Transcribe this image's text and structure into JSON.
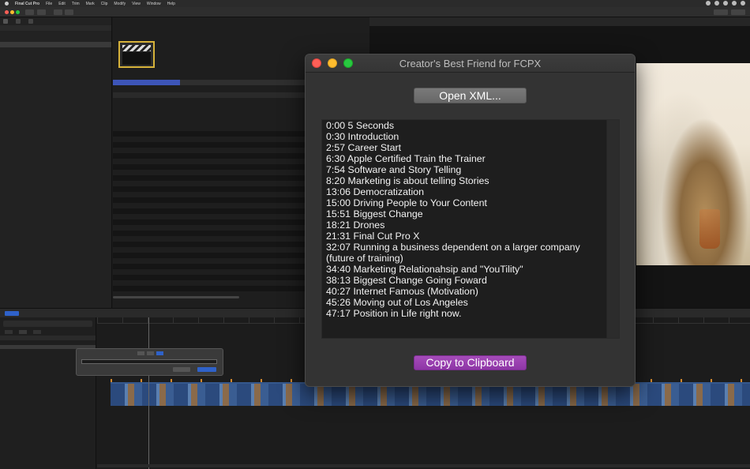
{
  "menubar": {
    "items": [
      "Final Cut Pro",
      "File",
      "Edit",
      "Trim",
      "Mark",
      "Clip",
      "Modify",
      "View",
      "Window",
      "Help"
    ]
  },
  "dialog": {
    "title": "Creator's Best Friend for FCPX",
    "open_button": "Open XML...",
    "copy_button": "Copy to Clipboard",
    "chapters": [
      "0:00 5 Seconds",
      "0:30 Introduction",
      "2:57 Career Start",
      "6:30 Apple Certified Train the Trainer",
      "7:54 Software and Story Telling",
      "8:20 Marketing is about telling Stories",
      "13:06 Democratization",
      "15:00 Driving People to Your Content",
      "15:51 Biggest Change",
      "18:21 Drones",
      "21:31 Final Cut Pro X",
      "32:07 Running a business dependent on a larger company (future of training)",
      "34:40 Marketing Relationahsip and \"YouTility\"",
      "38:13 Biggest Change Going Foward",
      "40:27 Internet Famous (Motivation)",
      "45:26 Moving out of Los Angeles",
      "47:17 Position in Life right now."
    ]
  },
  "colors": {
    "copy_button": "#9a42b2",
    "close": "#fe5f57",
    "minimize": "#febc2e",
    "zoom": "#28c840",
    "selection": "#3d55b8",
    "clip_blue": "#2b4a7d"
  }
}
